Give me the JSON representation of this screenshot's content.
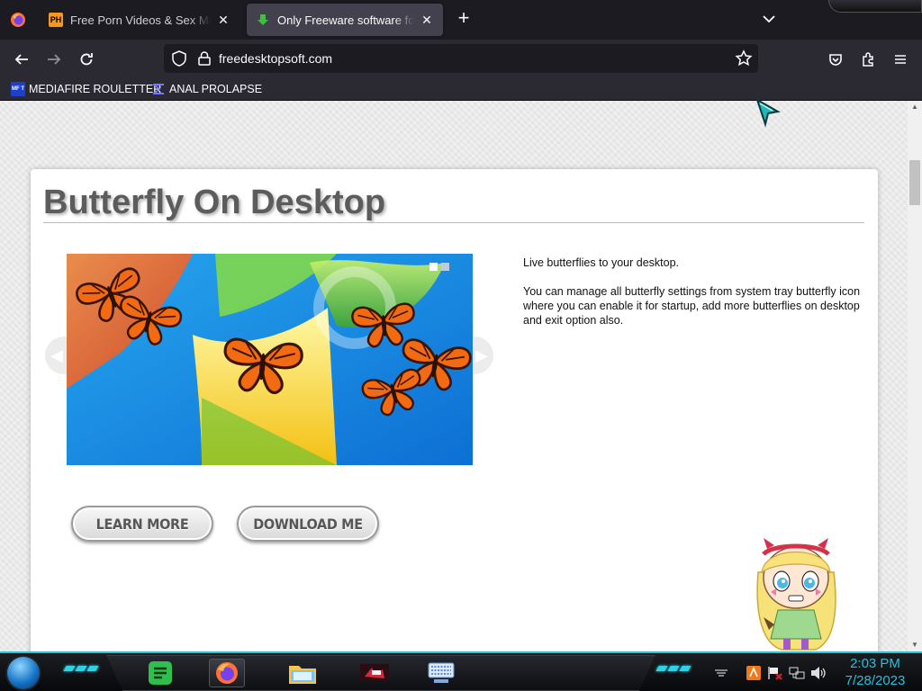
{
  "browser": {
    "tabs": [
      {
        "label": "Free Porn Videos & Sex Movies",
        "favicon": "PH",
        "active": false
      },
      {
        "label": "Only Freeware software for your",
        "favicon": "download-arrow",
        "active": true
      }
    ],
    "url": "freedesktopsoft.com",
    "bookmarks": [
      {
        "label": "MEDIAFIRE ROULETTER",
        "icon_text": "MF T"
      },
      {
        "label": "ANAL PROLAPSE",
        "icon": "sigma"
      }
    ]
  },
  "page": {
    "title": "Butterfly On Desktop",
    "description": [
      "Live butterflies to your desktop.",
      "You can manage all butterfly settings from system tray butterfly icon where you can enable it for startup, add more butterflies on desktop and exit option also."
    ],
    "buttons": {
      "learn_more": "LEARN MORE",
      "download": "DOWNLOAD ME"
    },
    "slider": {
      "slides": 2,
      "current": 1
    }
  },
  "taskbar": {
    "time": "2:03 PM",
    "date": "7/28/2023",
    "accent": "#2cc2d6"
  }
}
